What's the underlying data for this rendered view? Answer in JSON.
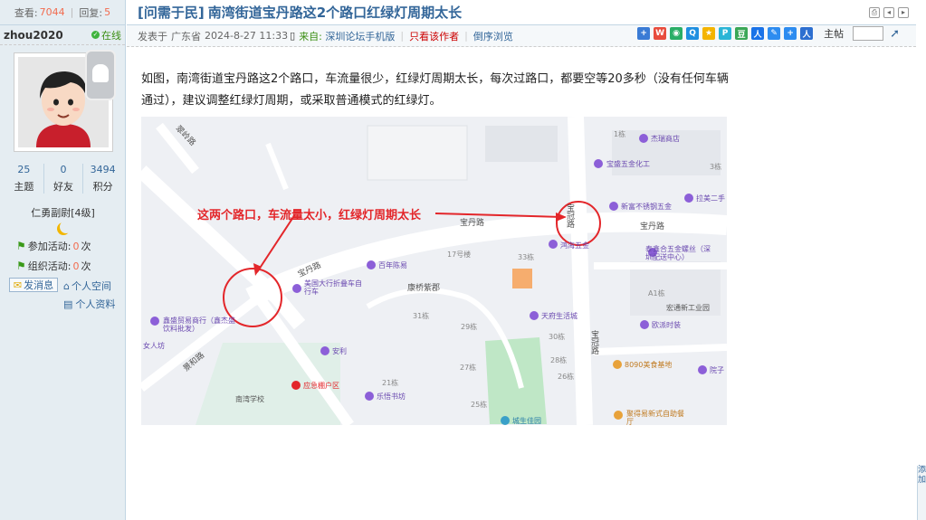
{
  "thread_stats": {
    "views_label": "查看:",
    "views": "7044",
    "replies_label": "回复:",
    "replies": "5"
  },
  "author": {
    "username": "zhou2020",
    "online_label": "在线",
    "topics_value": "25",
    "topics_label": "主题",
    "friends_value": "0",
    "friends_label": "好友",
    "points_value": "3494",
    "points_label": "积分",
    "rank": "仁勇副尉[4级]",
    "joined_activities_label": "参加活动:",
    "joined_activities_value": "0",
    "joined_unit": "次",
    "organized_activities_label": "组织活动:",
    "organized_activities_value": "0",
    "organized_unit": "次",
    "send_message_label": "发消息",
    "personal_space_label": "个人空间",
    "personal_profile_label": "个人资料"
  },
  "post": {
    "category": "[问需于民]",
    "title": "南湾街道宝丹路这2个路口红绿灯周期太长",
    "posted_prefix": "发表于",
    "location": "广东省",
    "datetime": "2024-8-27 11:33",
    "from_prefix": "来自:",
    "from_source": "深圳论坛手机版",
    "only_author_label": "只看该作者",
    "reverse_order_label": "倒序浏览",
    "jump_label": "主帖",
    "body": "如图，南湾街道宝丹路这2个路口，车流量很少，红绿灯周期太长，每次过路口，都要空等20多秒（没有任何车辆通过），建议调整红绿灯周期，或采取普通模式的红绿灯。"
  },
  "map_labels": {
    "annotation": "这两个路口，车流量太小，红绿灯周期太长",
    "road_baodan_1": "宝丹路",
    "road_baodan_2": "宝丹路",
    "road_baodan_3": "宝丹路",
    "road_baoguan_1": "宝冠路",
    "road_baoguan_2": "宝冠路",
    "road_cuiling": "翠岭路",
    "road_jinghe": "景和路",
    "poi_xingwang": "杰瑞商店",
    "poi_hardware": "宝盛五金化工",
    "poi_stainless": "新富不锈钢五金",
    "poi_secondhand": "拉美二手",
    "poi_wujin": "鸿海五金",
    "poi_taixin": "泰鑫合五金螺丝（深圳配送中心）",
    "poi_baisheng": "百年陈易",
    "poi_car": "美国大行折叠车自行车",
    "poi_kangqiao": "康桥紫郡",
    "poi_tianfu": "天府生活城",
    "poi_xindong": "欧派时装",
    "poi_tianyuan": "宏通新工业园",
    "poi_hongxin": "鑫盛贸易商行（鑫杰盛饮料批发）",
    "poi_anli": "安利",
    "poi_yingji": "应急棚户区",
    "poi_nanwan_school": "南湾学校",
    "poi_leyue": "乐悟书坊",
    "poi_dashi": "8090美食基地",
    "poi_yuanzi": "院子",
    "poi_meishi": "聚得易新式自助餐厅",
    "poi_chengsheng": "城生佳园",
    "poi_nuren": "女人坊",
    "poi_21dong": "21栋",
    "poi_25dong": "25栋",
    "poi_27dong": "27栋",
    "poi_29dong": "29栋",
    "poi_31dong": "31栋",
    "poi_33dong": "33栋",
    "poi_30dong": "30栋",
    "poi_28dong": "28栋",
    "poi_26dong": "26栋",
    "poi_a1dong": "A1栋",
    "poi_1dong": "1栋",
    "poi_3dong": "3栋",
    "poi_17dong": "17号楼"
  },
  "right_strip": {
    "text": "添加"
  },
  "colors": {
    "link": "#336699",
    "accent_red": "#e3262a",
    "online_green": "#3a8e12",
    "sidebar_bg": "#e5edf2"
  }
}
